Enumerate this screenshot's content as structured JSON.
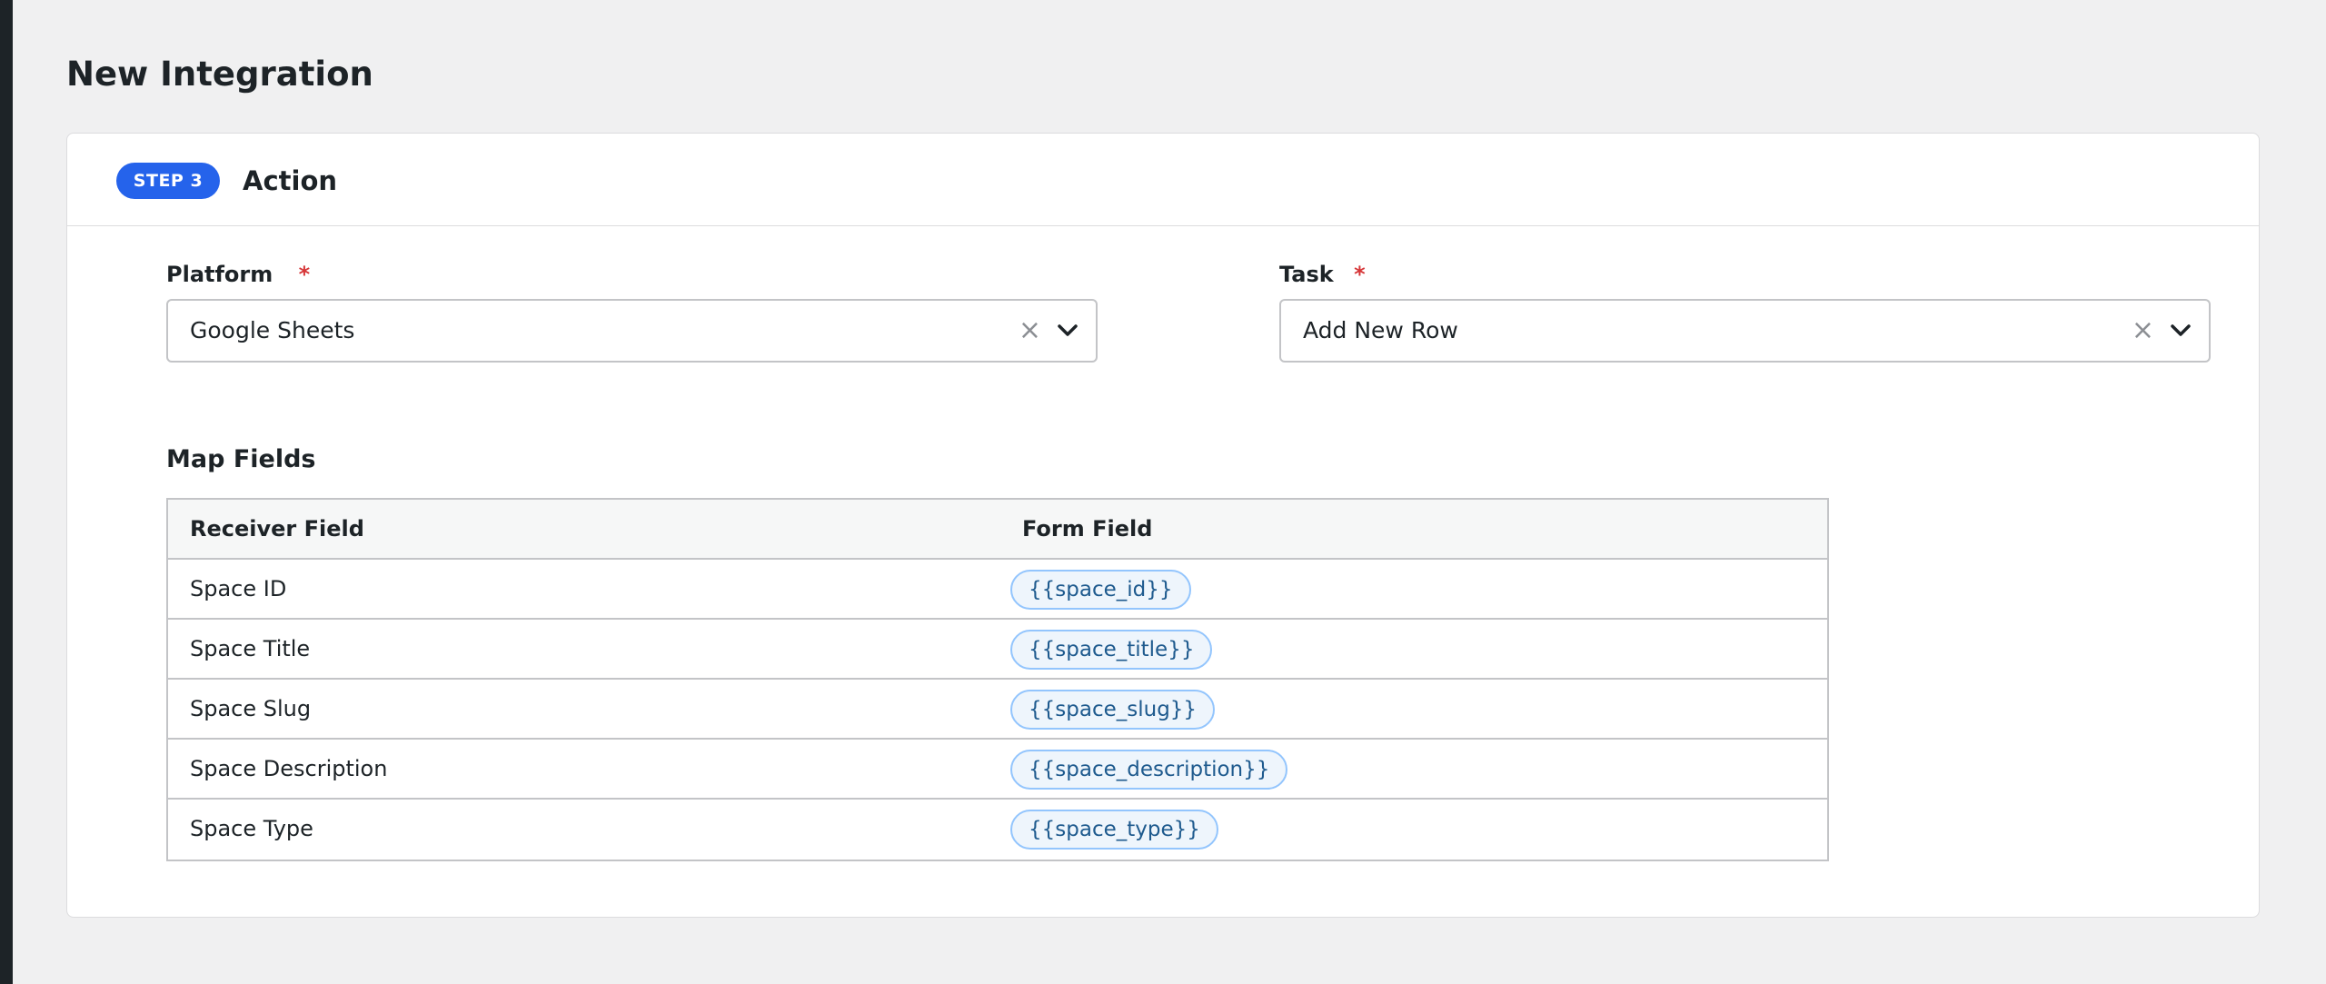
{
  "page": {
    "title": "New Integration"
  },
  "step": {
    "badge": "STEP 3",
    "title": "Action"
  },
  "platform": {
    "label": "Platform",
    "required": "*",
    "value": "Google Sheets",
    "clear": "×"
  },
  "task": {
    "label": "Task",
    "required": "*",
    "value": "Add New Row",
    "clear": "×"
  },
  "map_fields": {
    "title": "Map Fields",
    "columns": [
      "Receiver Field",
      "Form Field"
    ],
    "rows": [
      {
        "receiver": "Space ID",
        "form": "{{space_id}}"
      },
      {
        "receiver": "Space Title",
        "form": "{{space_title}}"
      },
      {
        "receiver": "Space Slug",
        "form": "{{space_slug}}"
      },
      {
        "receiver": "Space Description",
        "form": "{{space_description}}"
      },
      {
        "receiver": "Space Type",
        "form": "{{space_type}}"
      }
    ]
  },
  "colors": {
    "accent": "#2563eb",
    "required": "#d63638",
    "chip_bg": "#eef5fc",
    "chip_border": "#93c5fd",
    "chip_text": "#1e5a8e"
  },
  "icons": {
    "select_toggle": "chevron-down-icon",
    "select_clear": "close-icon"
  }
}
